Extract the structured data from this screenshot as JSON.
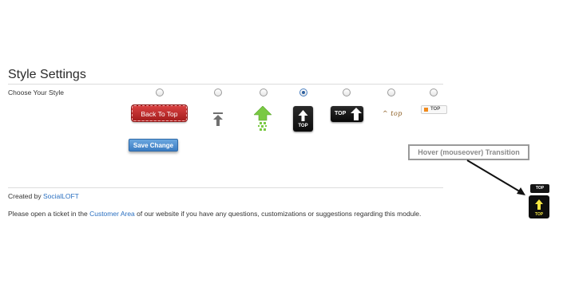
{
  "header": {
    "title": "Style Settings"
  },
  "style_picker": {
    "label": "Choose Your Style",
    "selected_index": 3,
    "options": [
      {
        "name": "red-button",
        "label": "Back To Top"
      },
      {
        "name": "grey-arrow",
        "label": ""
      },
      {
        "name": "green-arrow",
        "label": ""
      },
      {
        "name": "black-box",
        "label": "TOP"
      },
      {
        "name": "black-wide",
        "label": "TOP"
      },
      {
        "name": "handwritten",
        "label": "^ top"
      },
      {
        "name": "orange-tag",
        "label": "TOP"
      }
    ]
  },
  "actions": {
    "save_label": "Save Change"
  },
  "footer": {
    "created_prefix": "Created by ",
    "created_link": "SocialLOFT",
    "support_prefix": "Please open a ticket in the ",
    "support_link": "Customer Area",
    "support_suffix": " of our website if you have any questions, customizations or suggestions regarding this module."
  },
  "annotation": {
    "callout": "Hover (mouseover) Transition",
    "preview_top_label": "TOP",
    "preview_hover_label": "TOP"
  },
  "colors": {
    "link": "#2a6fc0",
    "save_button": "#4a8ad0",
    "red_button": "#c22c2c",
    "green_arrow": "#7ac943",
    "hover_arrow": "#f5e642"
  }
}
